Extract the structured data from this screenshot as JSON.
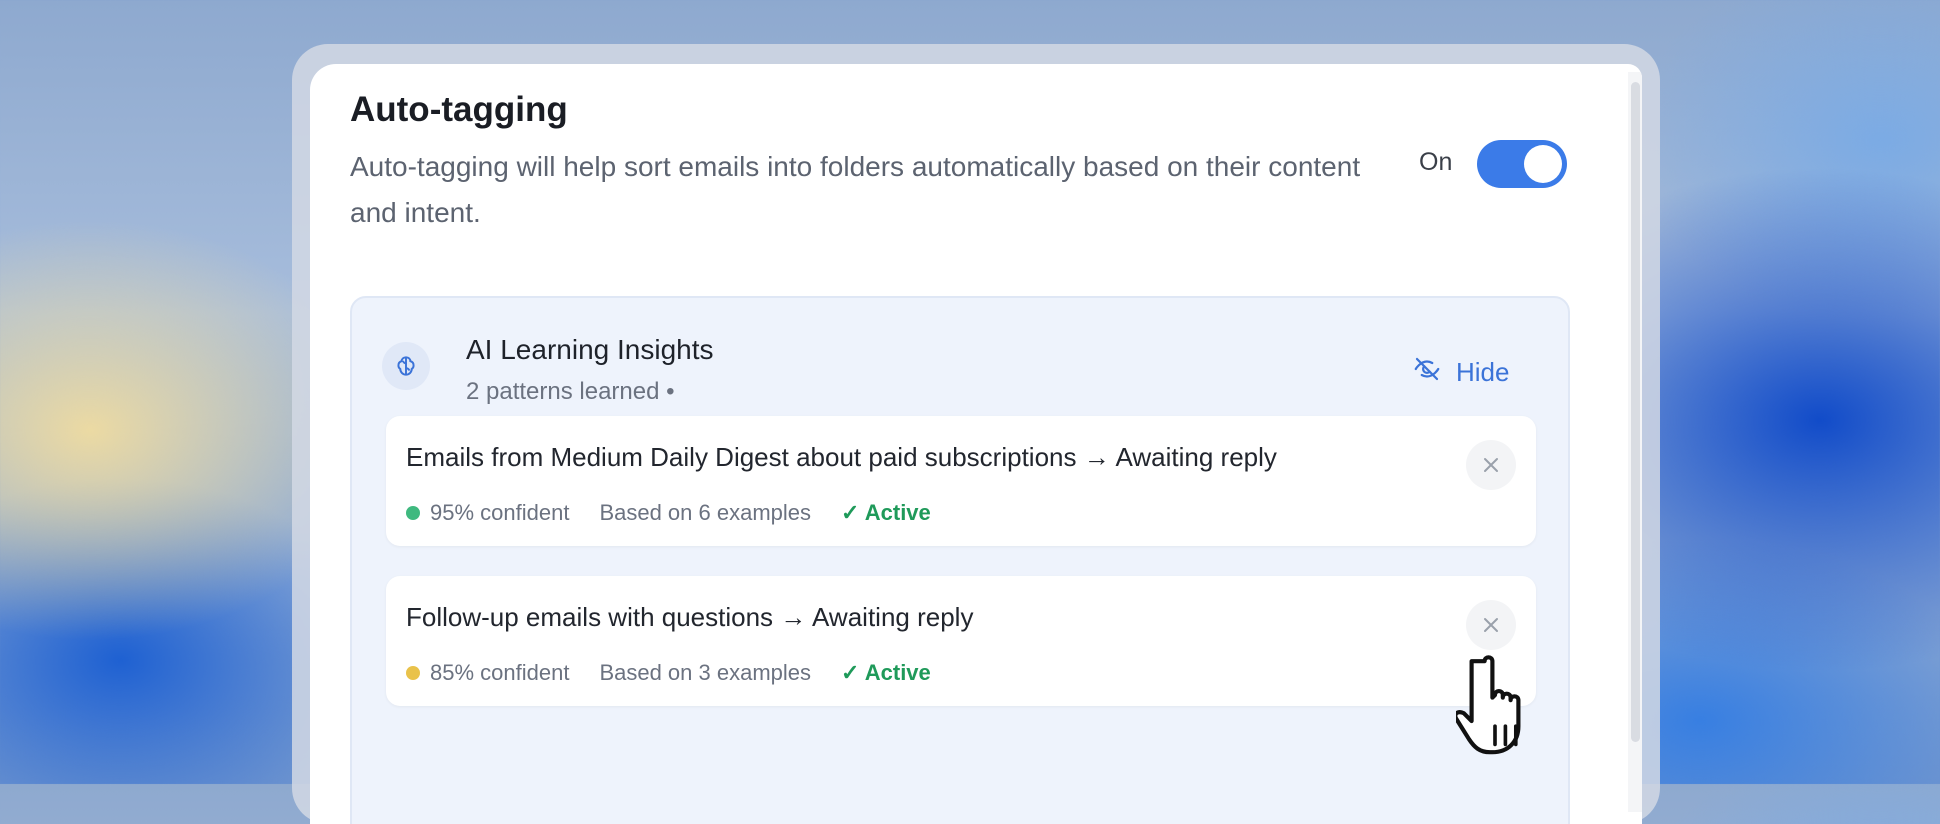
{
  "panel": {
    "title": "Auto-tagging",
    "description": "Auto-tagging will help sort emails into folders automatically based on their content and intent.",
    "toggle_label": "On",
    "toggle_on": true,
    "accent_color": "#3b7be8"
  },
  "insights": {
    "title": "AI Learning Insights",
    "subtitle": "2 patterns learned •",
    "hide_label": "Hide",
    "icon": "brain-icon",
    "patterns": [
      {
        "text": "Emails from Medium Daily Digest about paid subscriptions → Awaiting reply",
        "confidence": "95% confident",
        "confidence_color": "#3fb97f",
        "examples": "Based on 6 examples",
        "status": "✓ Active"
      },
      {
        "text": "Follow-up emails with questions → Awaiting reply",
        "confidence": "85% confident",
        "confidence_color": "#e9c24a",
        "examples": "Based on 3 examples",
        "status": "✓ Active"
      }
    ]
  },
  "status_color": "#1f9a5a"
}
